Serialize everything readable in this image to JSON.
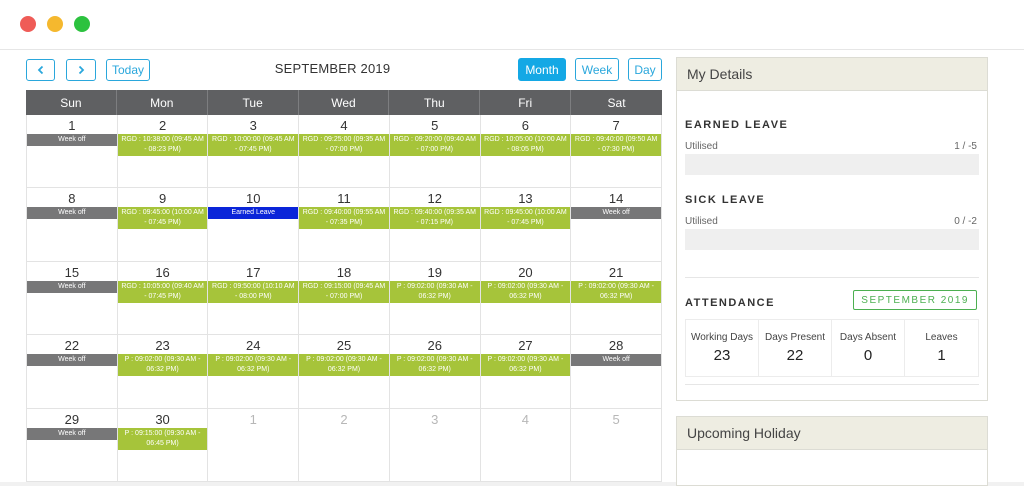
{
  "window": {
    "controls": [
      "close",
      "minimize",
      "maximize"
    ]
  },
  "toolbar": {
    "prev_icon": "chevron-left-icon",
    "next_icon": "chevron-right-icon",
    "today_label": "Today",
    "month_title": "SEPTEMBER 2019",
    "view_month": "Month",
    "view_week": "Week",
    "view_day": "Day",
    "active_view": "Month"
  },
  "calendar": {
    "weekdays": [
      "Sun",
      "Mon",
      "Tue",
      "Wed",
      "Thu",
      "Fri",
      "Sat"
    ],
    "weeks": [
      [
        {
          "day": "1",
          "events": [
            {
              "type": "off",
              "text": "Week off"
            }
          ]
        },
        {
          "day": "2",
          "events": [
            {
              "type": "work",
              "text": "RGD : 10:38:00 (09:45 AM - 08:23 PM)"
            }
          ]
        },
        {
          "day": "3",
          "events": [
            {
              "type": "work",
              "text": "RGD : 10:00:00 (09:45 AM - 07:45 PM)"
            }
          ]
        },
        {
          "day": "4",
          "events": [
            {
              "type": "work",
              "text": "RGD : 09:25:00 (09:35 AM - 07:00 PM)"
            }
          ]
        },
        {
          "day": "5",
          "events": [
            {
              "type": "work",
              "text": "RGD : 09:20:00 (09:40 AM - 07:00 PM)"
            }
          ]
        },
        {
          "day": "6",
          "events": [
            {
              "type": "work",
              "text": "RGD : 10:05:00 (10:00 AM - 08:05 PM)"
            }
          ]
        },
        {
          "day": "7",
          "events": [
            {
              "type": "work",
              "text": "RGD : 09:40:00 (09:50 AM - 07:30 PM)"
            }
          ]
        }
      ],
      [
        {
          "day": "8",
          "events": [
            {
              "type": "off",
              "text": "Week off"
            }
          ]
        },
        {
          "day": "9",
          "events": [
            {
              "type": "work",
              "text": "RGD : 09:45:00 (10:00 AM - 07:45 PM)"
            }
          ]
        },
        {
          "day": "10",
          "events": [
            {
              "type": "leave",
              "text": "Earned Leave"
            }
          ]
        },
        {
          "day": "11",
          "events": [
            {
              "type": "work",
              "text": "RGD : 09:40:00 (09:55 AM - 07:35 PM)"
            }
          ]
        },
        {
          "day": "12",
          "events": [
            {
              "type": "work",
              "text": "RGD : 09:40:00 (09:35 AM - 07:15 PM)"
            }
          ]
        },
        {
          "day": "13",
          "events": [
            {
              "type": "work",
              "text": "RGD : 09:45:00 (10:00 AM - 07:45 PM)"
            }
          ]
        },
        {
          "day": "14",
          "events": [
            {
              "type": "off",
              "text": "Week off"
            }
          ]
        }
      ],
      [
        {
          "day": "15",
          "events": [
            {
              "type": "off",
              "text": "Week off"
            }
          ]
        },
        {
          "day": "16",
          "events": [
            {
              "type": "work",
              "text": "RGD : 10:05:00 (09:40 AM - 07:45 PM)"
            }
          ]
        },
        {
          "day": "17",
          "events": [
            {
              "type": "work",
              "text": "RGD : 09:50:00 (10:10 AM - 08:00 PM)"
            }
          ]
        },
        {
          "day": "18",
          "events": [
            {
              "type": "work",
              "text": "RGD : 09:15:00 (09:45 AM - 07:00 PM)"
            }
          ]
        },
        {
          "day": "19",
          "events": [
            {
              "type": "work",
              "text": "P : 09:02:00 (09:30 AM - 06:32 PM)"
            }
          ]
        },
        {
          "day": "20",
          "events": [
            {
              "type": "work",
              "text": "P : 09:02:00 (09:30 AM - 06:32 PM)"
            }
          ]
        },
        {
          "day": "21",
          "events": [
            {
              "type": "work",
              "text": "P : 09:02:00 (09:30 AM - 06:32 PM)"
            }
          ]
        }
      ],
      [
        {
          "day": "22",
          "events": [
            {
              "type": "off",
              "text": "Week off"
            }
          ]
        },
        {
          "day": "23",
          "events": [
            {
              "type": "work",
              "text": "P : 09:02:00 (09:30 AM - 06:32 PM)"
            }
          ]
        },
        {
          "day": "24",
          "events": [
            {
              "type": "work",
              "text": "P : 09:02:00 (09:30 AM - 06:32 PM)"
            }
          ]
        },
        {
          "day": "25",
          "events": [
            {
              "type": "work",
              "text": "P : 09:02:00 (09:30 AM - 06:32 PM)"
            }
          ]
        },
        {
          "day": "26",
          "events": [
            {
              "type": "work",
              "text": "P : 09:02:00 (09:30 AM - 06:32 PM)"
            }
          ]
        },
        {
          "day": "27",
          "events": [
            {
              "type": "work",
              "text": "P : 09:02:00 (09:30 AM - 06:32 PM)"
            }
          ]
        },
        {
          "day": "28",
          "events": [
            {
              "type": "off",
              "text": "Week off"
            }
          ]
        }
      ],
      [
        {
          "day": "29",
          "events": [
            {
              "type": "off",
              "text": "Week off"
            }
          ]
        },
        {
          "day": "30",
          "events": [
            {
              "type": "work",
              "text": "P : 09:15:00 (09:30 AM - 06:45 PM)"
            }
          ]
        },
        {
          "day": "1",
          "other": true,
          "events": []
        },
        {
          "day": "2",
          "other": true,
          "events": []
        },
        {
          "day": "3",
          "other": true,
          "events": []
        },
        {
          "day": "4",
          "other": true,
          "events": []
        },
        {
          "day": "5",
          "other": true,
          "events": []
        }
      ]
    ]
  },
  "my_details": {
    "title": "My Details",
    "earned_leave": {
      "title": "EARNED LEAVE",
      "label": "Utilised",
      "value": "1 / -5"
    },
    "sick_leave": {
      "title": "SICK LEAVE",
      "label": "Utilised",
      "value": "0 / -2"
    },
    "attendance": {
      "title": "ATTENDANCE",
      "month": "SEPTEMBER 2019",
      "stats": [
        {
          "label": "Working Days",
          "value": "23"
        },
        {
          "label": "Days Present",
          "value": "22"
        },
        {
          "label": "Days Absent",
          "value": "0"
        },
        {
          "label": "Leaves",
          "value": "1"
        }
      ]
    }
  },
  "upcoming_holiday": {
    "title": "Upcoming Holiday"
  },
  "colors": {
    "accent": "#14a8e5",
    "work_event": "#a6c43a",
    "week_off": "#777778",
    "earned_leave": "#0a25d9",
    "header": "#5f6062",
    "badge": "#4caf50"
  }
}
